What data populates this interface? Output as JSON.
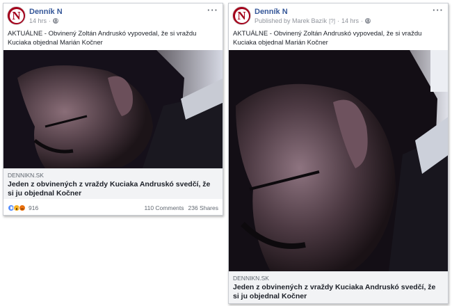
{
  "colors": {
    "brand_red": "#a3001b",
    "link_blue": "#365899",
    "meta_gray": "#90949c",
    "link_box_bg": "#f2f3f5"
  },
  "posts": [
    {
      "page_name": "Denník N",
      "avatar_letter": "N",
      "timestamp": "14 hrs",
      "privacy_icon": "globe-icon",
      "menu_icon": "more-options-icon",
      "text_label": "AKTUÁLNE",
      "text_body": " - Obvinený Zoltán Andruskó vypovedal, že si vraždu Kuciaka objednal Marián Kočner",
      "image_icon": "photo-man-profile-dark",
      "link_domain": "DENNIKN.SK",
      "link_title": "Jeden z obvinených z vraždy Kuciaka Andruskó svedčí, že si ju objednal Kočner",
      "reactions": [
        "like",
        "wow",
        "angry"
      ],
      "reaction_count": "916",
      "comments": "110 Comments",
      "shares": "236 Shares"
    },
    {
      "page_name": "Denník N",
      "avatar_letter": "N",
      "published_by": "Published by Marek Bazík",
      "info_mark": "[?]",
      "timestamp": "14 hrs",
      "privacy_icon": "globe-icon",
      "menu_icon": "more-options-icon",
      "text_label": "AKTUÁLNE",
      "text_body": " - Obvinený Zoltán Andruskó vypovedal, že si vraždu Kuciaka objednal Marián Kočner",
      "image_icon": "photo-man-profile-dark",
      "link_domain": "DENNIKN.SK",
      "link_title": "Jeden z obvinených z vraždy Kuciaka Andruskó svedčí, že si ju objednal Kočner"
    }
  ]
}
